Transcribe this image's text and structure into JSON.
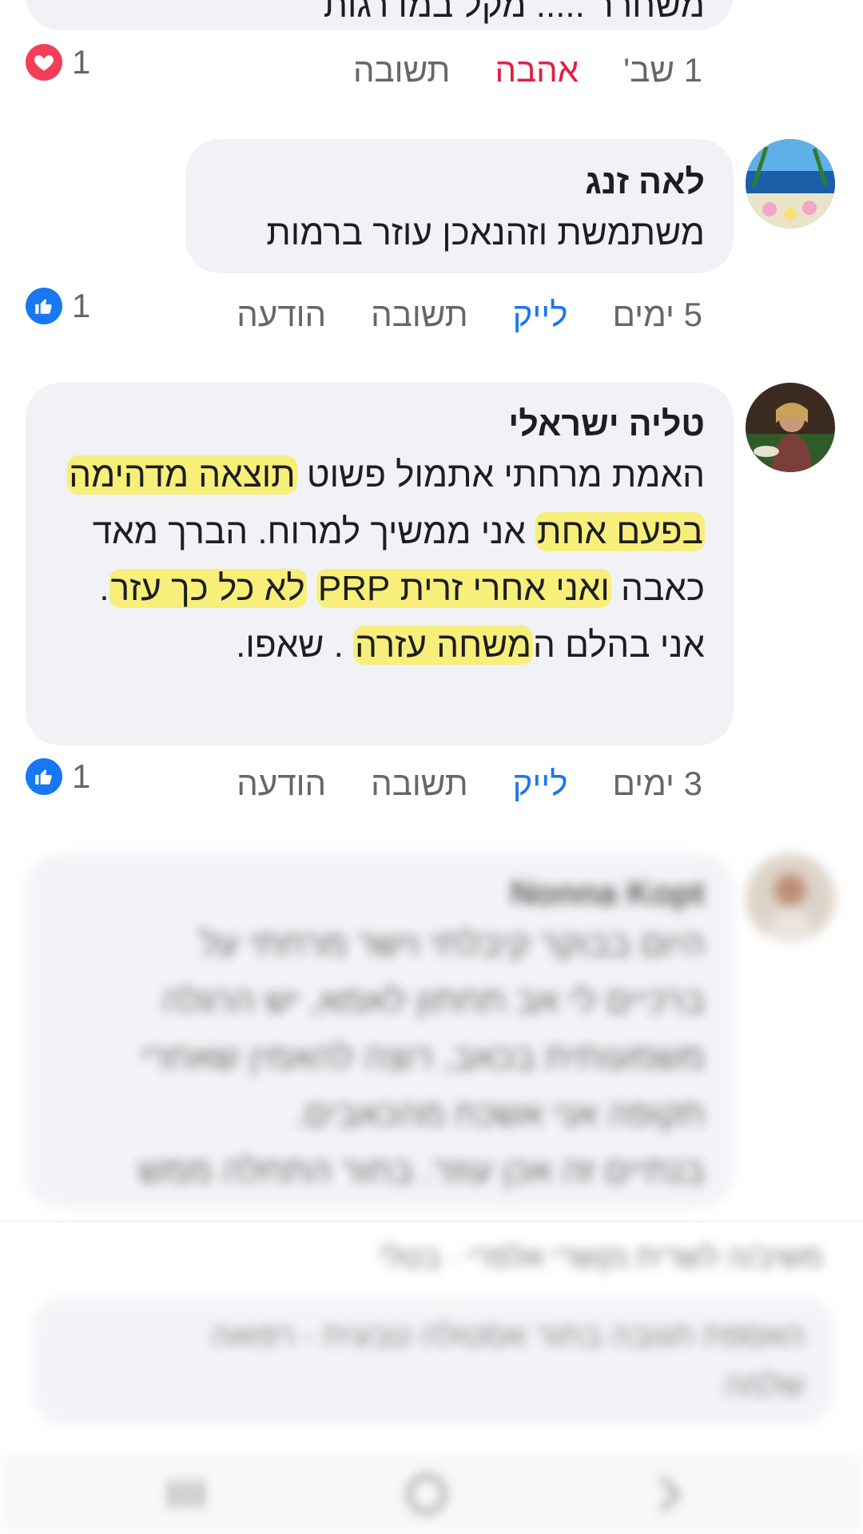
{
  "top": {
    "partial_text": "משחרר ..... מקל במדרגות",
    "time": "1 שב'",
    "love_label": "אהבה",
    "reply_label": "תשובה",
    "reaction_count": "1",
    "reaction_icon": "heart-icon",
    "reaction_color": "#f33e58"
  },
  "comments": [
    {
      "author": "לאה זנג",
      "lines": [
        "משתמשת וזהנאכן עוזר ברמות"
      ],
      "time": "5 ימים",
      "like_label": "לייק",
      "reply_label": "תשובה",
      "report_label": "הודעה",
      "reaction_count": "1",
      "reaction_icon": "thumbs-up-icon"
    },
    {
      "author": "טליה ישראלי",
      "segments": [
        {
          "t": "האמת מרחתי אתמול פשוט ",
          "h": false
        },
        {
          "t": "תוצאה מדהימה",
          "h": true
        },
        {
          "t": " ",
          "h": false
        },
        {
          "t": "בפעם אחת",
          "h": true
        },
        {
          "t": " אני ממשיך למרוח. הברך מאד כאבה ",
          "h": false
        },
        {
          "t": "ואני אחרי זרית PRP",
          "h": true
        },
        {
          "t": " ",
          "h": false
        },
        {
          "t": "לא כל כך עזר",
          "h": true
        },
        {
          "t": ". אני בהלם ה",
          "h": false
        },
        {
          "t": "משחה עזרה",
          "h": true
        },
        {
          "t": " . שאפו.",
          "h": false
        }
      ],
      "time": "3 ימים",
      "like_label": "לייק",
      "reply_label": "תשובה",
      "report_label": "הודעה",
      "reaction_count": "1",
      "reaction_icon": "thumbs-up-icon"
    },
    {
      "author": "Nonna Kopt",
      "lines": [
        "היום בבוקר קיבלתי וישר מרחתי על",
        "ברכיים לי אב תחתון לאמא, יש הרגלה",
        "משמעותית בכאב, רוצה להאמין שאחרי",
        "תקופה אני אשכח מהכאבים.",
        "בנתיים זה אכן עוזר. בחור התחלה ממש"
      ]
    }
  ],
  "reply_bar": {
    "replying_to": "משיב/ה לשרית נקשרי אלפרי · בטלי",
    "placeholder_lines": [
      "האספת תגובה בתור אסטולה טבעית - רפואה",
      "שלמה"
    ]
  },
  "colors": {
    "bubble": "#f0f2f5",
    "like_blue": "#1877f2",
    "love_red": "#e41e3f",
    "meta_gray": "#65676b",
    "highlight": "#f7ef7a"
  },
  "navbar": {
    "icons": [
      "recent-apps-icon",
      "home-icon",
      "back-icon"
    ]
  }
}
